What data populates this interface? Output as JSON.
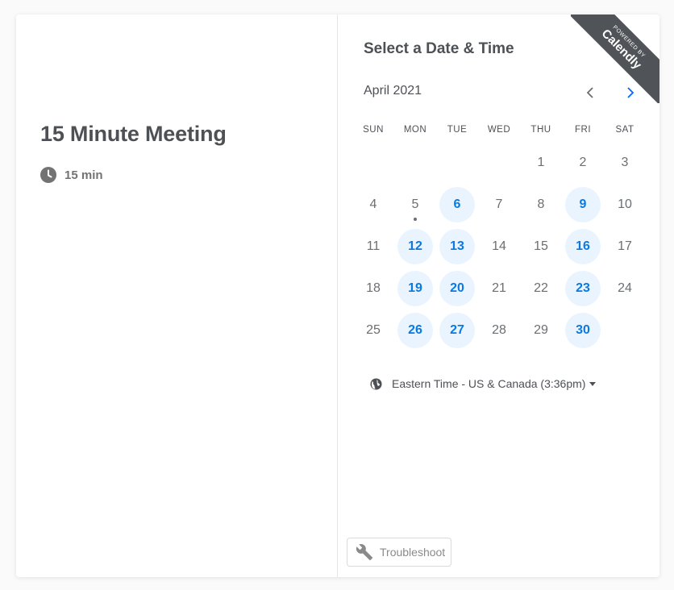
{
  "event": {
    "title": "15 Minute Meeting",
    "duration": "15 min"
  },
  "picker": {
    "title": "Select a Date & Time",
    "month": "April 2021",
    "weekdays": [
      "SUN",
      "MON",
      "TUE",
      "WED",
      "THU",
      "FRI",
      "SAT"
    ],
    "days": [
      {
        "label": "",
        "available": false
      },
      {
        "label": "",
        "available": false
      },
      {
        "label": "",
        "available": false
      },
      {
        "label": "",
        "available": false
      },
      {
        "label": "1",
        "available": false
      },
      {
        "label": "2",
        "available": false
      },
      {
        "label": "3",
        "available": false
      },
      {
        "label": "4",
        "available": false
      },
      {
        "label": "5",
        "available": false,
        "today": true
      },
      {
        "label": "6",
        "available": true
      },
      {
        "label": "7",
        "available": false
      },
      {
        "label": "8",
        "available": false
      },
      {
        "label": "9",
        "available": true
      },
      {
        "label": "10",
        "available": false
      },
      {
        "label": "11",
        "available": false
      },
      {
        "label": "12",
        "available": true
      },
      {
        "label": "13",
        "available": true
      },
      {
        "label": "14",
        "available": false
      },
      {
        "label": "15",
        "available": false
      },
      {
        "label": "16",
        "available": true
      },
      {
        "label": "17",
        "available": false
      },
      {
        "label": "18",
        "available": false
      },
      {
        "label": "19",
        "available": true
      },
      {
        "label": "20",
        "available": true
      },
      {
        "label": "21",
        "available": false
      },
      {
        "label": "22",
        "available": false
      },
      {
        "label": "23",
        "available": true
      },
      {
        "label": "24",
        "available": false
      },
      {
        "label": "25",
        "available": false
      },
      {
        "label": "26",
        "available": true
      },
      {
        "label": "27",
        "available": true
      },
      {
        "label": "28",
        "available": false
      },
      {
        "label": "29",
        "available": false
      },
      {
        "label": "30",
        "available": true
      },
      {
        "label": "",
        "available": false
      }
    ],
    "timezone": "Eastern Time - US & Canada (3:36pm)"
  },
  "troubleshoot": {
    "label": "Troubleshoot",
    "icon": "wrench-icon"
  },
  "badge": {
    "line1": "POWERED BY",
    "brand": "Calendly"
  },
  "colors": {
    "accent": "#0069ff",
    "available_bg": "#eaf4fe",
    "ribbon": "#505357"
  }
}
